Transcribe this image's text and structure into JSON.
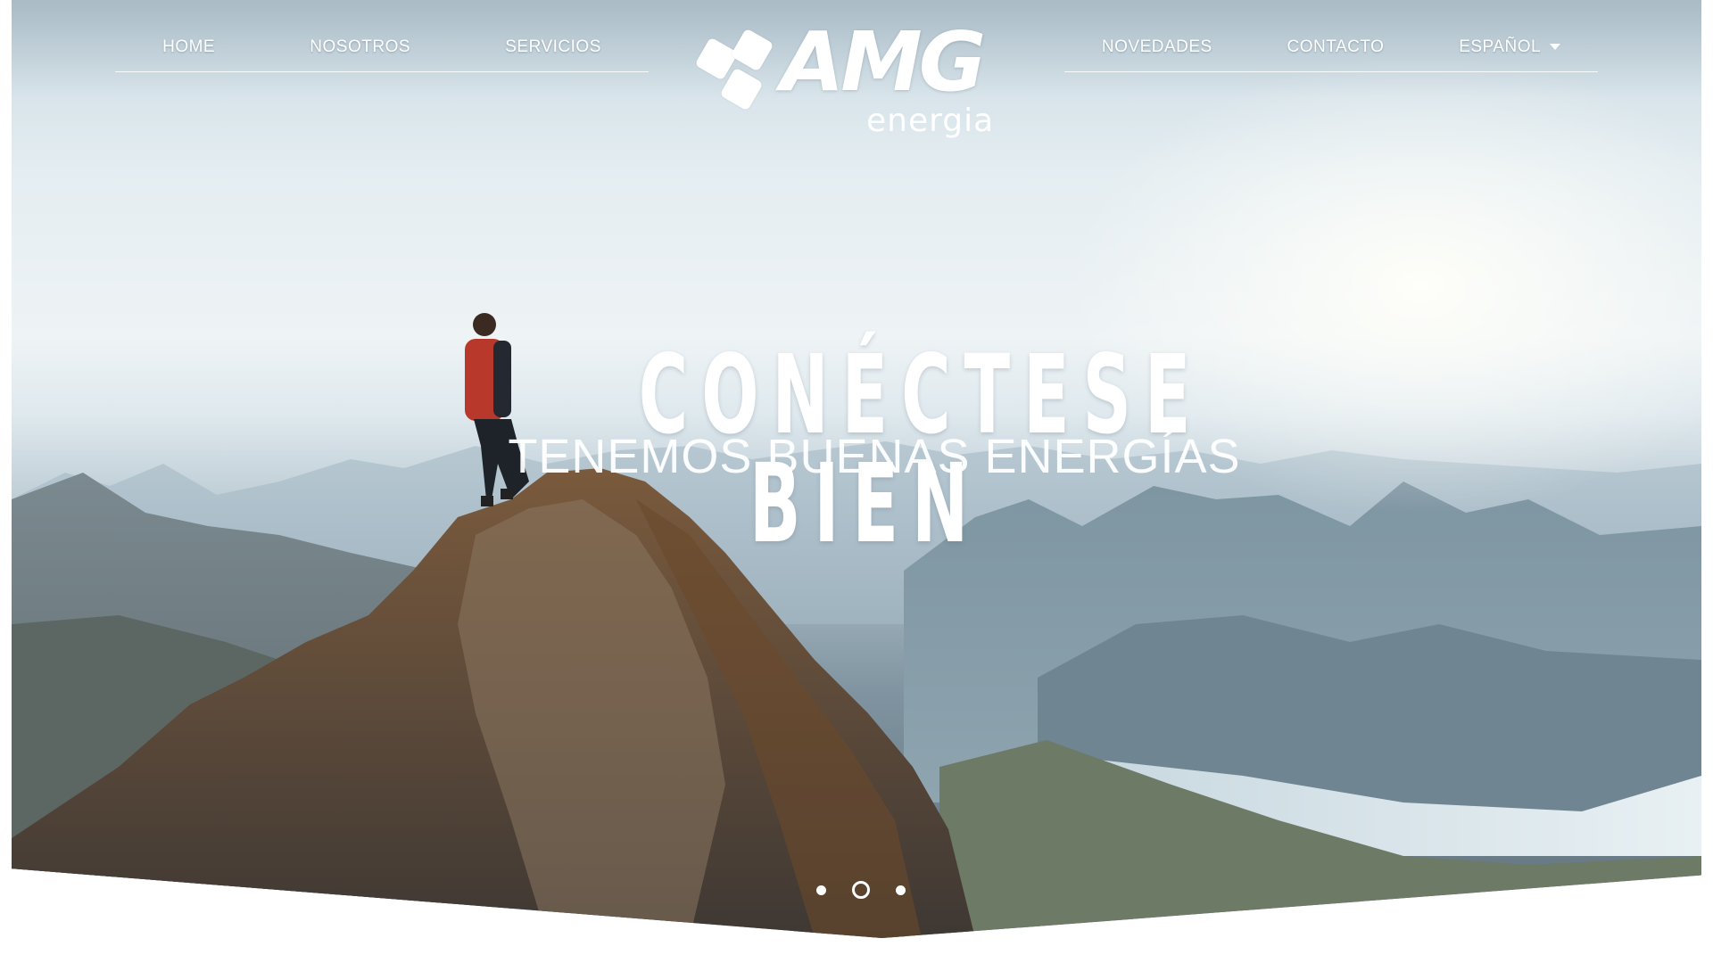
{
  "nav": {
    "left": [
      "HOME",
      "NOSOTROS",
      "SERVICIOS"
    ],
    "right": [
      "NOVEDADES",
      "CONTACTO"
    ],
    "language": "ESPAÑOL"
  },
  "logo": {
    "brand": "AMG",
    "sub": "energia"
  },
  "hero": {
    "headline": "CONÉCTESE BIEN",
    "subheadline": "TENEMOS BUENAS ENERGÍAS"
  },
  "slider": {
    "count": 3,
    "active_index": 1
  },
  "colors": {
    "nav_text": "#ffffff",
    "underline": "#ffffff",
    "background": "#ffffff"
  }
}
